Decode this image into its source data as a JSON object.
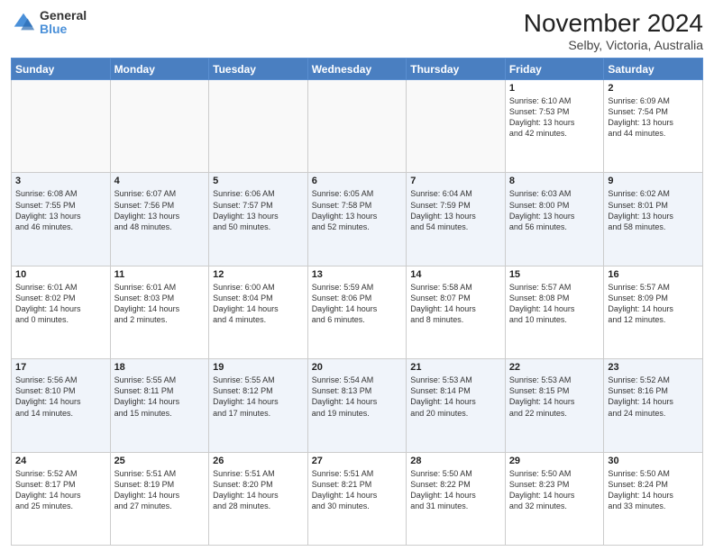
{
  "header": {
    "logo_general": "General",
    "logo_blue": "Blue",
    "month_title": "November 2024",
    "location": "Selby, Victoria, Australia"
  },
  "days_of_week": [
    "Sunday",
    "Monday",
    "Tuesday",
    "Wednesday",
    "Thursday",
    "Friday",
    "Saturday"
  ],
  "weeks": [
    [
      {
        "day": "",
        "info": ""
      },
      {
        "day": "",
        "info": ""
      },
      {
        "day": "",
        "info": ""
      },
      {
        "day": "",
        "info": ""
      },
      {
        "day": "",
        "info": ""
      },
      {
        "day": "1",
        "info": "Sunrise: 6:10 AM\nSunset: 7:53 PM\nDaylight: 13 hours\nand 42 minutes."
      },
      {
        "day": "2",
        "info": "Sunrise: 6:09 AM\nSunset: 7:54 PM\nDaylight: 13 hours\nand 44 minutes."
      }
    ],
    [
      {
        "day": "3",
        "info": "Sunrise: 6:08 AM\nSunset: 7:55 PM\nDaylight: 13 hours\nand 46 minutes."
      },
      {
        "day": "4",
        "info": "Sunrise: 6:07 AM\nSunset: 7:56 PM\nDaylight: 13 hours\nand 48 minutes."
      },
      {
        "day": "5",
        "info": "Sunrise: 6:06 AM\nSunset: 7:57 PM\nDaylight: 13 hours\nand 50 minutes."
      },
      {
        "day": "6",
        "info": "Sunrise: 6:05 AM\nSunset: 7:58 PM\nDaylight: 13 hours\nand 52 minutes."
      },
      {
        "day": "7",
        "info": "Sunrise: 6:04 AM\nSunset: 7:59 PM\nDaylight: 13 hours\nand 54 minutes."
      },
      {
        "day": "8",
        "info": "Sunrise: 6:03 AM\nSunset: 8:00 PM\nDaylight: 13 hours\nand 56 minutes."
      },
      {
        "day": "9",
        "info": "Sunrise: 6:02 AM\nSunset: 8:01 PM\nDaylight: 13 hours\nand 58 minutes."
      }
    ],
    [
      {
        "day": "10",
        "info": "Sunrise: 6:01 AM\nSunset: 8:02 PM\nDaylight: 14 hours\nand 0 minutes."
      },
      {
        "day": "11",
        "info": "Sunrise: 6:01 AM\nSunset: 8:03 PM\nDaylight: 14 hours\nand 2 minutes."
      },
      {
        "day": "12",
        "info": "Sunrise: 6:00 AM\nSunset: 8:04 PM\nDaylight: 14 hours\nand 4 minutes."
      },
      {
        "day": "13",
        "info": "Sunrise: 5:59 AM\nSunset: 8:06 PM\nDaylight: 14 hours\nand 6 minutes."
      },
      {
        "day": "14",
        "info": "Sunrise: 5:58 AM\nSunset: 8:07 PM\nDaylight: 14 hours\nand 8 minutes."
      },
      {
        "day": "15",
        "info": "Sunrise: 5:57 AM\nSunset: 8:08 PM\nDaylight: 14 hours\nand 10 minutes."
      },
      {
        "day": "16",
        "info": "Sunrise: 5:57 AM\nSunset: 8:09 PM\nDaylight: 14 hours\nand 12 minutes."
      }
    ],
    [
      {
        "day": "17",
        "info": "Sunrise: 5:56 AM\nSunset: 8:10 PM\nDaylight: 14 hours\nand 14 minutes."
      },
      {
        "day": "18",
        "info": "Sunrise: 5:55 AM\nSunset: 8:11 PM\nDaylight: 14 hours\nand 15 minutes."
      },
      {
        "day": "19",
        "info": "Sunrise: 5:55 AM\nSunset: 8:12 PM\nDaylight: 14 hours\nand 17 minutes."
      },
      {
        "day": "20",
        "info": "Sunrise: 5:54 AM\nSunset: 8:13 PM\nDaylight: 14 hours\nand 19 minutes."
      },
      {
        "day": "21",
        "info": "Sunrise: 5:53 AM\nSunset: 8:14 PM\nDaylight: 14 hours\nand 20 minutes."
      },
      {
        "day": "22",
        "info": "Sunrise: 5:53 AM\nSunset: 8:15 PM\nDaylight: 14 hours\nand 22 minutes."
      },
      {
        "day": "23",
        "info": "Sunrise: 5:52 AM\nSunset: 8:16 PM\nDaylight: 14 hours\nand 24 minutes."
      }
    ],
    [
      {
        "day": "24",
        "info": "Sunrise: 5:52 AM\nSunset: 8:17 PM\nDaylight: 14 hours\nand 25 minutes."
      },
      {
        "day": "25",
        "info": "Sunrise: 5:51 AM\nSunset: 8:19 PM\nDaylight: 14 hours\nand 27 minutes."
      },
      {
        "day": "26",
        "info": "Sunrise: 5:51 AM\nSunset: 8:20 PM\nDaylight: 14 hours\nand 28 minutes."
      },
      {
        "day": "27",
        "info": "Sunrise: 5:51 AM\nSunset: 8:21 PM\nDaylight: 14 hours\nand 30 minutes."
      },
      {
        "day": "28",
        "info": "Sunrise: 5:50 AM\nSunset: 8:22 PM\nDaylight: 14 hours\nand 31 minutes."
      },
      {
        "day": "29",
        "info": "Sunrise: 5:50 AM\nSunset: 8:23 PM\nDaylight: 14 hours\nand 32 minutes."
      },
      {
        "day": "30",
        "info": "Sunrise: 5:50 AM\nSunset: 8:24 PM\nDaylight: 14 hours\nand 33 minutes."
      }
    ]
  ]
}
